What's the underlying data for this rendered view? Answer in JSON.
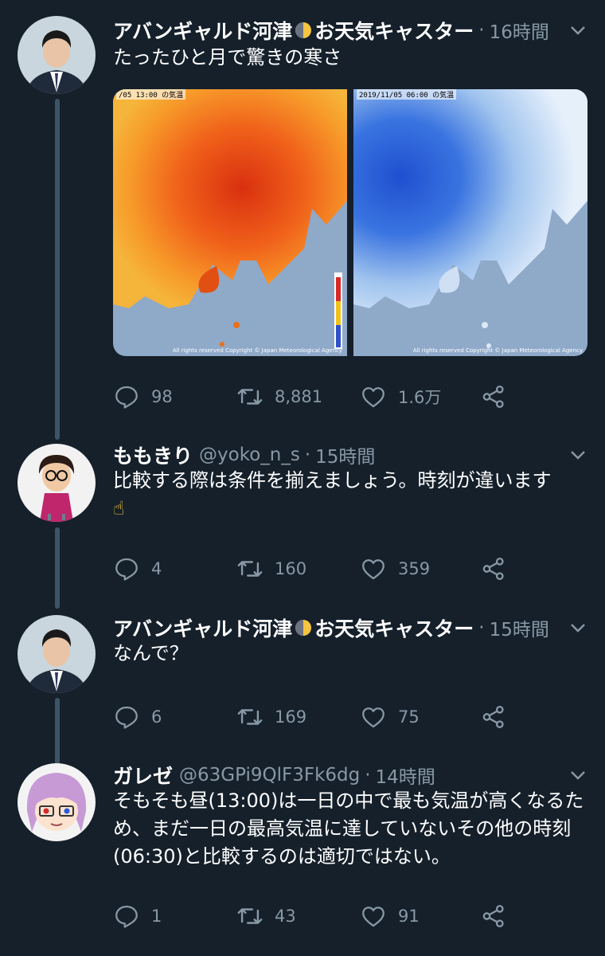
{
  "tweets": [
    {
      "name": "アバンギャルド河津",
      "name_suffix": "お天気キャスター",
      "time": "16時間",
      "text": "たったひと月で驚きの寒さ",
      "media": {
        "left_label": "/05 13:00 の気温",
        "right_label": "2019/11/05 06:00 の気温",
        "copyright": "All rights reserved Copyright © Japan Meteorological Agency"
      },
      "stats": {
        "replies": "98",
        "retweets": "8,881",
        "likes": "1.6万"
      }
    },
    {
      "name": "ももきり",
      "handle": "@yoko_n_s",
      "time": "15時間",
      "text": "比較する際は条件を揃えましょう。時刻が違います",
      "emoji": "☝",
      "stats": {
        "replies": "4",
        "retweets": "160",
        "likes": "359"
      }
    },
    {
      "name": "アバンギャルド河津",
      "name_suffix": "お天気キャスター",
      "time": "15時間",
      "text": "なんで？",
      "stats": {
        "replies": "6",
        "retweets": "169",
        "likes": "75"
      }
    },
    {
      "name": "ガレゼ",
      "handle": "@63GPi9QlF3Fk6dg",
      "time": "14時間",
      "text": "そもそも昼(13:00)は一日の中で最も気温が高くなるため、まだ一日の最高気温に達していないその他の時刻(06:30)と比較するのは適切ではない。",
      "stats": {
        "replies": "1",
        "retweets": "43",
        "likes": "91"
      }
    }
  ],
  "icons": {
    "reply": "reply-icon",
    "retweet": "retweet-icon",
    "like": "like-icon",
    "share": "share-icon",
    "more": "chevron-down-icon"
  },
  "colors": {
    "background": "#15202b",
    "secondary_text": "#8899a6",
    "thread_line": "#3d5466"
  }
}
